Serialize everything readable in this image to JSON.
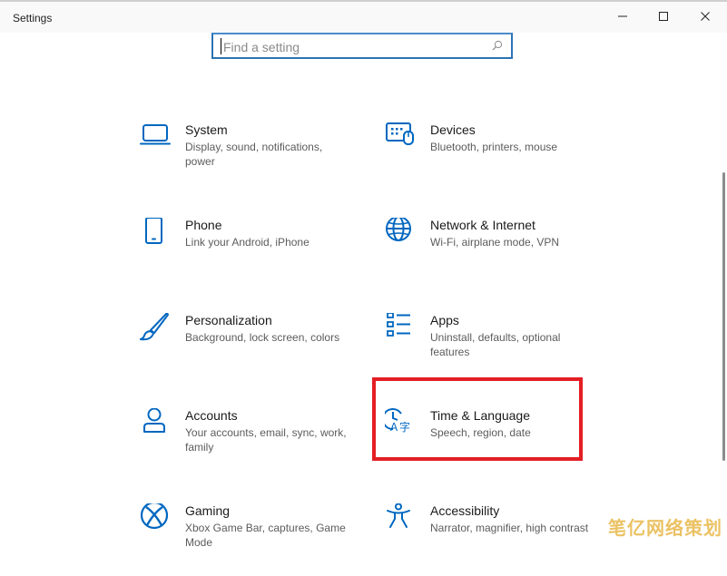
{
  "window": {
    "title": "Settings"
  },
  "search": {
    "placeholder": "Find a setting"
  },
  "categories": [
    {
      "title": "System",
      "description": "Display, sound, notifications, power",
      "icon": "laptop-icon"
    },
    {
      "title": "Devices",
      "description": "Bluetooth, printers, mouse",
      "icon": "devices-icon"
    },
    {
      "title": "Phone",
      "description": "Link your Android, iPhone",
      "icon": "phone-icon"
    },
    {
      "title": "Network & Internet",
      "description": "Wi-Fi, airplane mode, VPN",
      "icon": "globe-icon"
    },
    {
      "title": "Personalization",
      "description": "Background, lock screen, colors",
      "icon": "brush-icon"
    },
    {
      "title": "Apps",
      "description": "Uninstall, defaults, optional features",
      "icon": "apps-list-icon"
    },
    {
      "title": "Accounts",
      "description": "Your accounts, email, sync, work, family",
      "icon": "person-icon"
    },
    {
      "title": "Time & Language",
      "description": "Speech, region, date",
      "icon": "time-language-icon"
    },
    {
      "title": "Gaming",
      "description": "Xbox Game Bar, captures, Game Mode",
      "icon": "xbox-icon"
    },
    {
      "title": "Accessibility",
      "description": "Narrator, magnifier, high contrast",
      "icon": "accessibility-icon"
    }
  ],
  "watermark": "笔亿网络策划",
  "colors": {
    "accent": "#0067c0",
    "highlight": "#e31e24",
    "search_border": "#2c73b4"
  }
}
